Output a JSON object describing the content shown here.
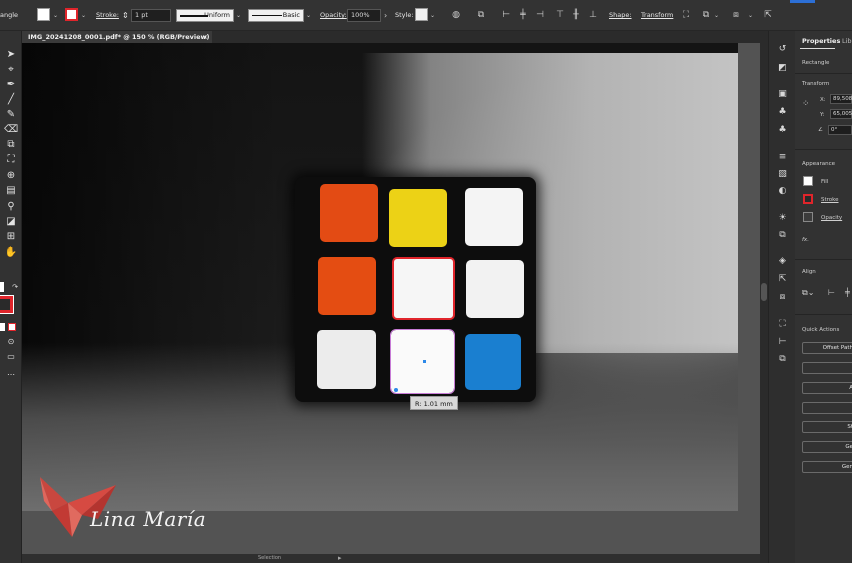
{
  "control_bar": {
    "cut_label": "angle",
    "stroke_label": "Stroke:",
    "stroke_weight": "1 pt",
    "profile_uniform": "Uniform",
    "brush_basic": "Basic",
    "opacity_label": "Opacity:",
    "opacity_value": "100%",
    "style_label": "Style:",
    "shape_label": "Shape:",
    "transform_label": "Transform"
  },
  "tab": {
    "title": "IMG_20241208_0001.pdf* @ 150 % (RGB/Preview)",
    "close": "×"
  },
  "canvas": {
    "tooltip": "R: 1.01 mm",
    "status_text": "Selection",
    "watermark_text": "Lina María",
    "cube_colors": [
      [
        "#e34b14",
        "#ecd216",
        "#f4f4f4"
      ],
      [
        "#e44d12",
        "#f6f6f6",
        "#f2f2f2"
      ],
      [
        "#ececec",
        "#fafafa",
        "#1a7fd0"
      ]
    ]
  },
  "properties": {
    "tab_properties": "Properties",
    "tab_libraries": "Libr",
    "object_type": "Rectangle",
    "transform_title": "Transform",
    "x_label": "X:",
    "x_value": "89,508",
    "y_label": "Y:",
    "y_value": "65,005",
    "angle_value": "0°",
    "appearance_title": "Appearance",
    "fill_label": "Fill",
    "stroke_label": "Stroke",
    "opacity_label": "Opacity",
    "fx_label": "fx.",
    "align_title": "Align",
    "quick_actions_title": "Quick Actions",
    "offset_path": "Offset Path",
    "btn_a": "A",
    "btn_st": "St",
    "btn_ge": "Ge",
    "btn_gen": "Gen"
  },
  "colors": {
    "stroke_red": "#e0252b",
    "selection_purple": "#c77bd6",
    "anchor_blue": "#2c88e8"
  }
}
